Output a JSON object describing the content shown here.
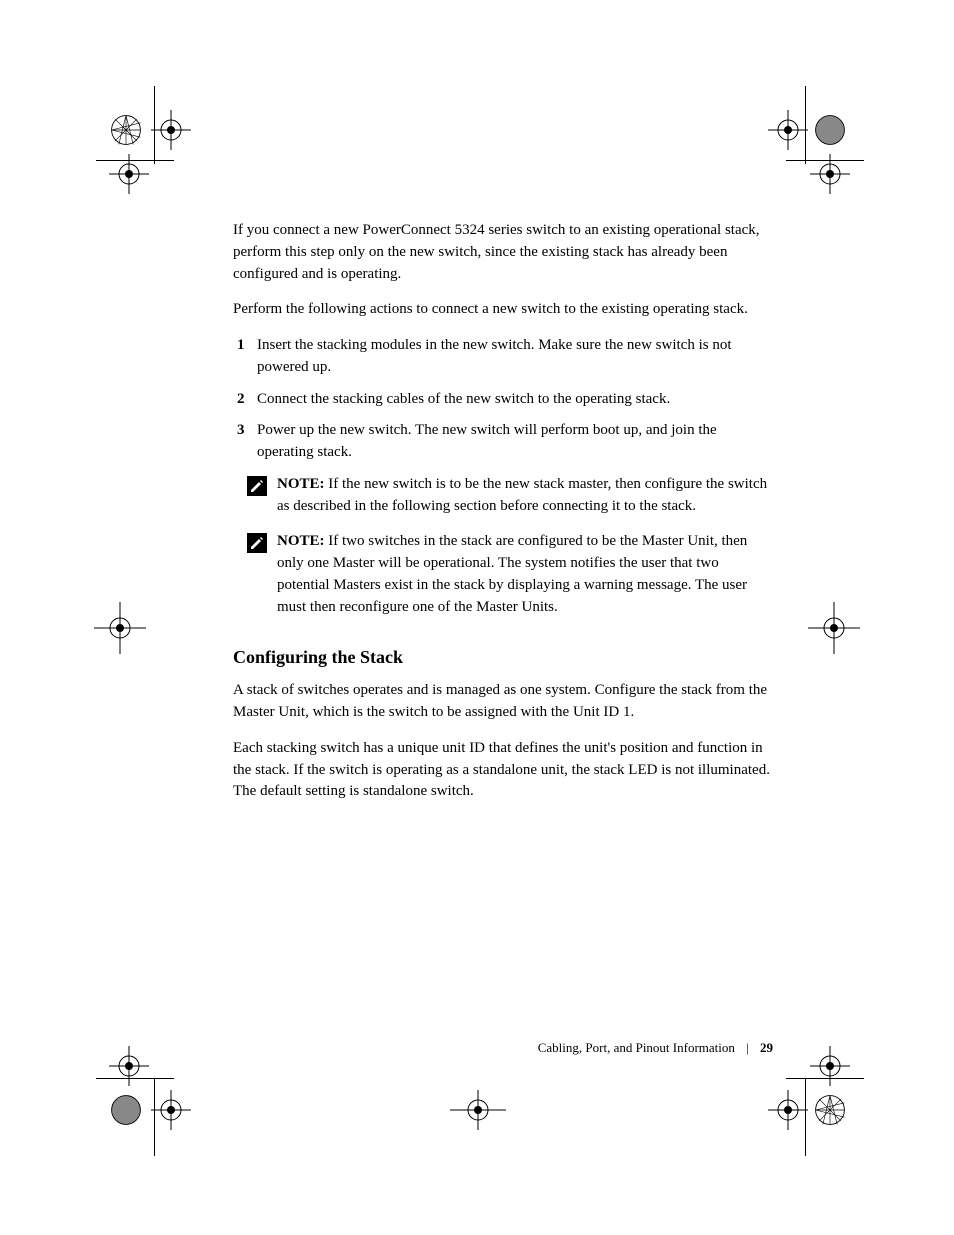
{
  "paragraphs": {
    "p1": "If you connect a new PowerConnect 5324 series switch to an existing operational stack, perform this step only on the new switch, since the existing stack has already been configured and is operating.",
    "p2": "Perform the following actions to connect a new switch to the existing operating stack."
  },
  "steps": {
    "s1": {
      "num": "1",
      "text": "Insert the stacking modules in the new switch. Make sure the new switch is not powered up."
    },
    "s2": {
      "num": "2",
      "text": "Connect the stacking cables of the new switch to the operating stack."
    },
    "s3": {
      "num": "3",
      "text": "Power up the new switch. The new switch will perform boot up, and join the operating stack."
    }
  },
  "notes": {
    "n1": {
      "label": "NOTE:",
      "text": "If the new switch is to be the new stack master, then configure the switch as described in the following section before connecting it to the stack."
    },
    "n2": {
      "label": "NOTE:",
      "text": "If two switches in the stack are configured to be the Master Unit, then only one Master will be operational. The system notifies the user that two potential Masters exist in the stack by displaying a warning message. The user must then reconfigure one of the Master Units."
    }
  },
  "section": {
    "heading": "Configuring the Stack",
    "body1": "A stack of switches operates and is managed as one system. Configure the stack from the Master Unit, which is the switch to be assigned with the Unit ID 1.",
    "body2": "Each stacking switch has a unique unit ID that defines the unit's position and function in the stack. If the switch is operating as a standalone unit, the stack LED is not illuminated. The default setting is standalone switch."
  },
  "footer": {
    "label": "Cabling, Port, and Pinout Information",
    "page": "29"
  }
}
